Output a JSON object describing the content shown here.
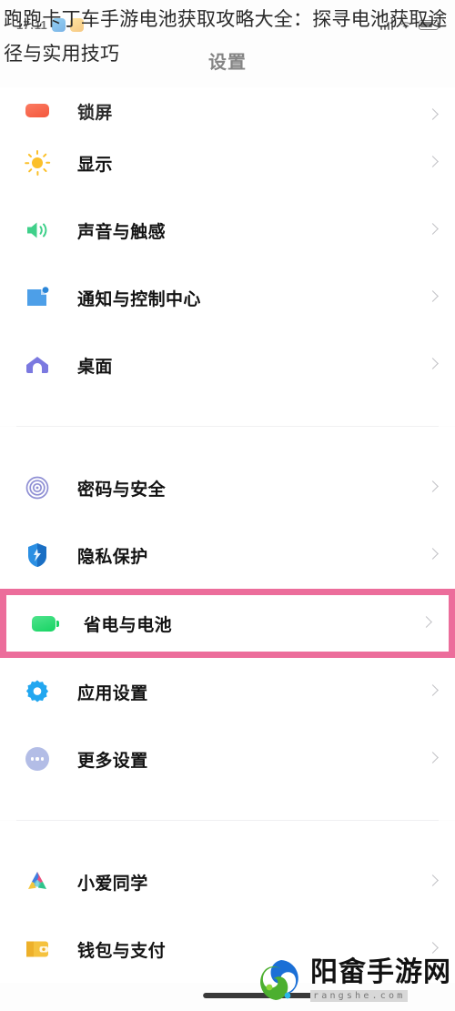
{
  "overlay": {
    "article_title": "跑跑卡丁车手游电池获取攻略大全：探寻电池获取途径与实用技巧"
  },
  "status_bar": {
    "time": "17:11",
    "icons": [
      "app-icon-blue",
      "app-icon-amber",
      "signal-icon",
      "wifi-icon",
      "battery-icon"
    ]
  },
  "header": {
    "title": "设置"
  },
  "settings": {
    "groups": [
      {
        "name": "display-group",
        "items": [
          {
            "label": "锁屏",
            "icon": "lock-screen-icon",
            "icon_color": "#f4573c",
            "clipped": true
          },
          {
            "label": "显示",
            "icon": "display-sun-icon",
            "icon_color": "#fbc02a",
            "clipped": false
          },
          {
            "label": "声音与触感",
            "icon": "sound-speaker-icon",
            "icon_color": "#3fd08a",
            "clipped": false
          },
          {
            "label": "通知与控制中心",
            "icon": "notification-icon",
            "icon_color": "#4d9fe8",
            "clipped": false
          },
          {
            "label": "桌面",
            "icon": "home-screen-icon",
            "icon_color": "#7b79e0",
            "clipped": false
          }
        ]
      },
      {
        "name": "security-group",
        "items": [
          {
            "label": "密码与安全",
            "icon": "fingerprint-icon",
            "icon_color": "#8f8fd4",
            "clipped": false
          },
          {
            "label": "隐私保护",
            "icon": "privacy-shield-icon",
            "icon_color": "#2b8fe3",
            "clipped": false
          },
          {
            "label": "省电与电池",
            "icon": "battery-saver-icon",
            "icon_color": "#17d463",
            "clipped": false,
            "highlighted": true
          },
          {
            "label": "应用设置",
            "icon": "app-settings-gear-icon",
            "icon_color": "#22a7f0",
            "clipped": false
          },
          {
            "label": "更多设置",
            "icon": "more-settings-icon",
            "icon_color": "#b3bde6",
            "clipped": false
          }
        ]
      },
      {
        "name": "services-group",
        "items": [
          {
            "label": "小爱同学",
            "icon": "xiaoai-assistant-icon",
            "icon_color": "#eb4f7d",
            "clipped": false
          },
          {
            "label": "钱包与支付",
            "icon": "wallet-icon",
            "icon_color": "#f5c23e",
            "clipped": false
          }
        ]
      }
    ]
  },
  "highlight": {
    "target_label": "省电与电池",
    "border_color": "#ec6d9b"
  },
  "watermark": {
    "site_name": "阳畲手游网",
    "url": "rangshe.com"
  },
  "nav": {
    "home_indicator": "home-indicator"
  }
}
